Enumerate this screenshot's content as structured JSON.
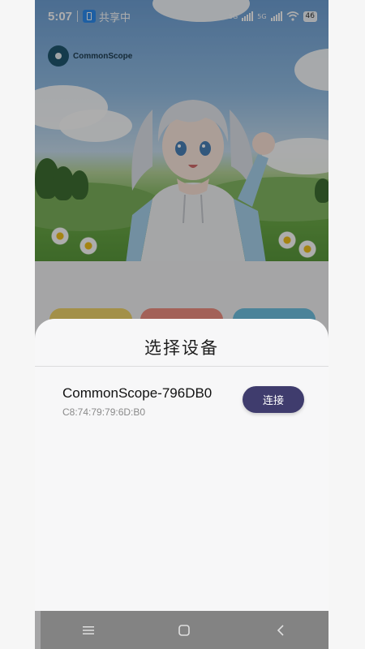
{
  "status_bar": {
    "time": "5:07",
    "share_label": "共享中",
    "network_1": "5G",
    "network_2": "5G",
    "battery": "46"
  },
  "app": {
    "logo_text": "CommonScope"
  },
  "dialog": {
    "title": "选择设备",
    "devices": [
      {
        "name": "CommonScope-796DB0",
        "mac": "C8:74:79:79:6D:B0",
        "action": "连接"
      }
    ]
  },
  "colors": {
    "connect_button": "#3f3c6d",
    "card_yellow": "#b8a86a",
    "card_red": "#b47a72",
    "card_blue": "#5e93a8"
  },
  "navigation": {
    "icons": [
      "menu-icon",
      "home-icon",
      "back-icon"
    ]
  }
}
